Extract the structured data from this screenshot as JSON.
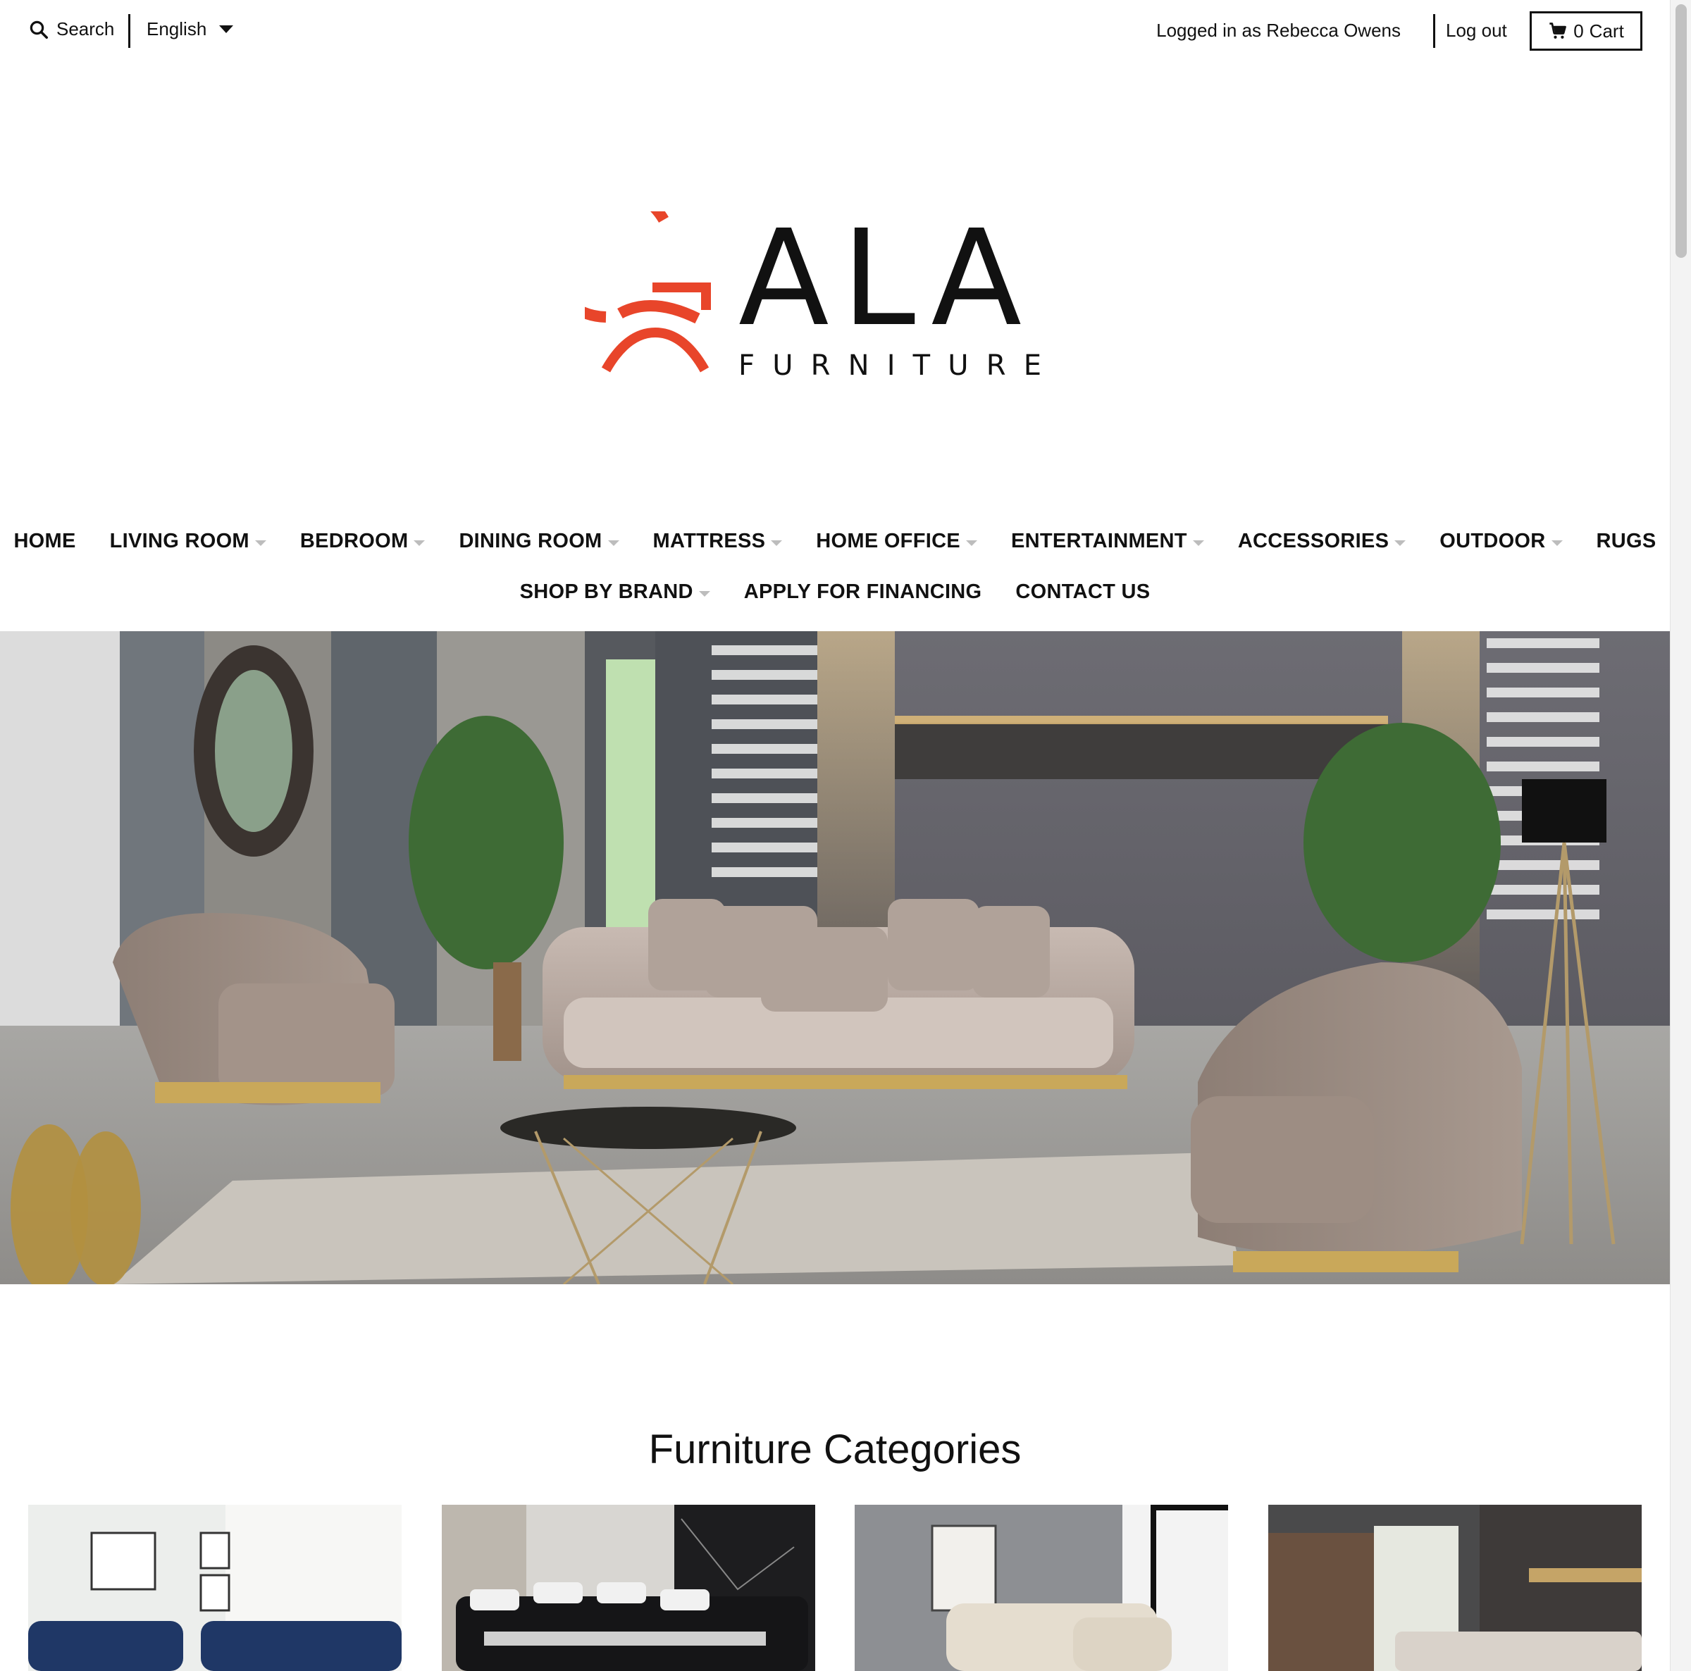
{
  "topbar": {
    "search_label": "Search",
    "language": "English",
    "logged_in_text": "Logged in as Rebecca Owens",
    "logout_label": "Log out",
    "cart_count": "0",
    "cart_label": "Cart"
  },
  "logo": {
    "wordmark": "ALA",
    "subline": "FURNITURE",
    "brand_color": "#e8452a"
  },
  "nav": {
    "row1": [
      {
        "label": "HOME",
        "dropdown": false
      },
      {
        "label": "LIVING ROOM",
        "dropdown": true
      },
      {
        "label": "BEDROOM",
        "dropdown": true
      },
      {
        "label": "DINING ROOM",
        "dropdown": true
      },
      {
        "label": "MATTRESS",
        "dropdown": true
      },
      {
        "label": "HOME OFFICE",
        "dropdown": true
      },
      {
        "label": "ENTERTAINMENT",
        "dropdown": true
      },
      {
        "label": "ACCESSORIES",
        "dropdown": true
      },
      {
        "label": "OUTDOOR",
        "dropdown": true
      },
      {
        "label": "RUGS",
        "dropdown": false
      }
    ],
    "row2": [
      {
        "label": "SHOP BY BRAND",
        "dropdown": true
      },
      {
        "label": "APPLY FOR FINANCING",
        "dropdown": false
      },
      {
        "label": "CONTACT US",
        "dropdown": false
      }
    ]
  },
  "categories": {
    "title": "Furniture Categories"
  },
  "colors": {
    "accent": "#e8452a",
    "text": "#111111",
    "caret": "#bdbdbd"
  }
}
